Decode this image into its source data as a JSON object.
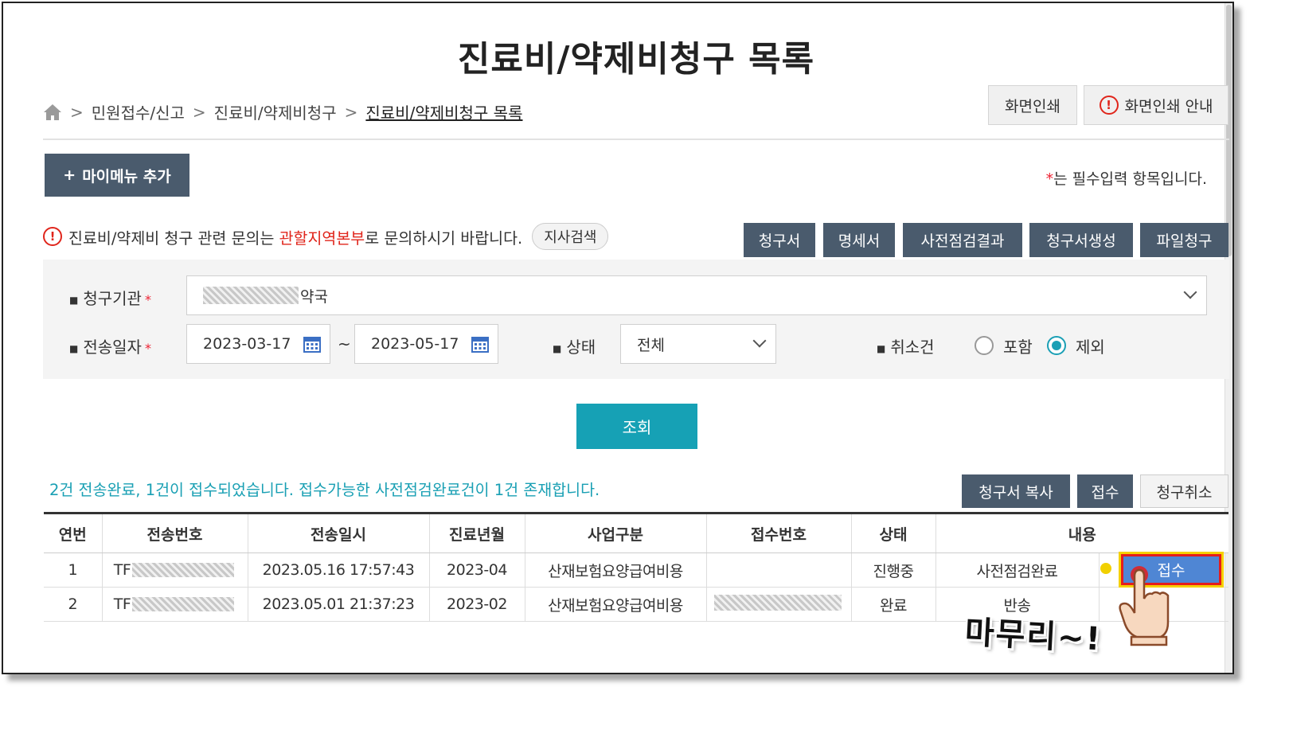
{
  "page": {
    "title": "진료비/약제비청구 목록"
  },
  "breadcrumb": {
    "items": [
      "민원접수/신고",
      "진료비/약제비청구",
      "진료비/약제비청구 목록"
    ]
  },
  "top_buttons": {
    "print": "화면인쇄",
    "print_guide": "화면인쇄 안내"
  },
  "mymenu": {
    "label": "마이메뉴 추가",
    "plus": "+"
  },
  "required_note": {
    "star": "*",
    "text": "는 필수입력 항목입니다."
  },
  "notice": {
    "before": "진료비/약제비 청구 관련 문의는 ",
    "highlight": "관할지역본부",
    "after": "로 문의하시기 바랍니다.",
    "branch_search": "지사검색"
  },
  "action_buttons": {
    "claim": "청구서",
    "statement": "명세서",
    "precheck": "사전점검결과",
    "create": "청구서생성",
    "file_claim": "파일청구"
  },
  "search": {
    "institution_label": "청구기관",
    "institution_value_suffix": "약국",
    "date_label": "전송일자",
    "date_from": "2023-03-17",
    "date_sep": "~",
    "date_to": "2023-05-17",
    "status_label": "상태",
    "status_value": "전체",
    "cancel_label": "취소건",
    "cancel_include": "포함",
    "cancel_exclude": "제외",
    "cancel_selected": "제외",
    "required_star": "*",
    "submit": "조회"
  },
  "results": {
    "message": "2건 전송완료, 1건이 접수되었습니다. 접수가능한 사전점검완료건이 1건 존재합니다.",
    "buttons": {
      "copy": "청구서 복사",
      "accept": "접수",
      "cancel": "청구취소"
    },
    "columns": [
      "연번",
      "전송번호",
      "전송일시",
      "진료년월",
      "사업구분",
      "접수번호",
      "상태",
      "내용"
    ],
    "rows": [
      {
        "no": "1",
        "send_prefix": "TF",
        "send_masked": "▒",
        "sent_at": "2023.05.16 17:57:43",
        "month": "2023-04",
        "business": "산재보험요양급여비용",
        "receipt_masked": "",
        "status": "진행중",
        "content": "사전점검완료",
        "row_button": "접수"
      },
      {
        "no": "2",
        "send_prefix": "TF",
        "send_masked": "▒",
        "sent_at": "2023.05.01 21:37:23",
        "month": "2023-02",
        "business": "산재보험요양급여비용",
        "receipt_masked": "▒",
        "status": "완료",
        "content": "반송",
        "row_button": ""
      }
    ]
  },
  "overlay": {
    "caption": "마무리~!"
  },
  "colors": {
    "accent": "#16a1b5",
    "dark_button": "#4a5b6d",
    "alert_red": "#e0251b",
    "highlight_yellow": "#f5d000"
  },
  "icons": [
    "home-icon",
    "alert-icon",
    "calendar-icon",
    "chevron-down-icon",
    "pointing-hand-icon"
  ]
}
